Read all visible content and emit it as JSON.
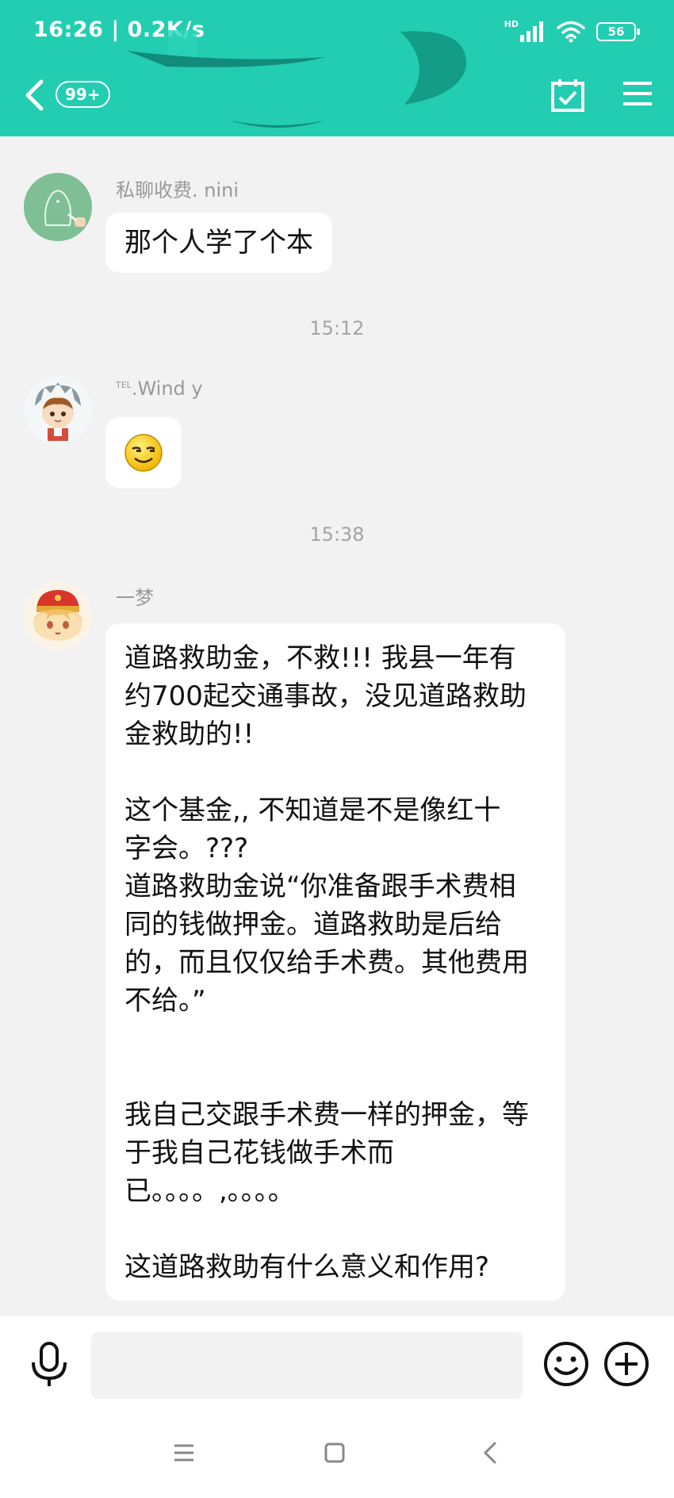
{
  "status_bar": {
    "time_speed": "16:26 | 0.2K/s",
    "hd": "HD",
    "battery": "56",
    "icons": [
      "signal-icon",
      "wifi-icon",
      "battery-icon"
    ]
  },
  "header": {
    "unread_badge": "99+",
    "icons": [
      "back-icon",
      "calendar-check-icon",
      "menu-icon"
    ],
    "accent_color": "#22cdb1"
  },
  "messages": [
    {
      "sender": "私聊收费. nini",
      "text": "那个人学了个本"
    },
    {
      "time": "15:12"
    },
    {
      "sender_sup": "TEL",
      "sender": ".Wind y",
      "sticker": "sly-smile-emoji"
    },
    {
      "time": "15:38"
    },
    {
      "sender": "一梦",
      "text": "道路救助金，不救!!! 我县一年有\n约700起交通事故，没见道路救助\n金救助的!!\n\n这个基金,, 不知道是不是像红十\n字会。???\n道路救助金说“你准备跟手术费相\n同的钱做押金。道路救助是后给\n的，而且仅仅给手术费。其他费用\n不给。”\n\n\n我自己交跟手术费一样的押金，等\n于我自己花钱做手术而\n已。。。。,。。。。\n\n这道路救助有什么意义和作用?"
    }
  ],
  "input_bar": {
    "placeholder": "",
    "icons": [
      "microphone-icon",
      "emoji-icon",
      "plus-icon"
    ]
  },
  "nav_bar": {
    "icons": [
      "recent-apps-icon",
      "home-icon",
      "back-nav-icon"
    ]
  }
}
